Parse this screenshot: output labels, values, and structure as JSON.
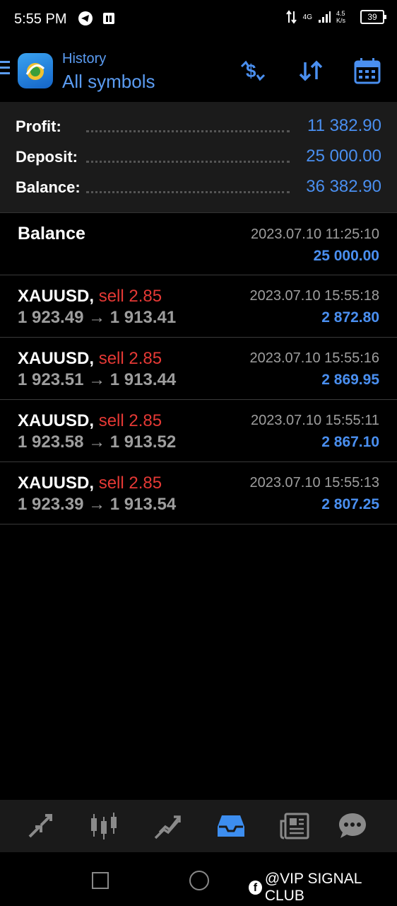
{
  "status": {
    "time": "5:55 PM",
    "network": "4G",
    "speed": "4.5 K/s",
    "battery": "39"
  },
  "header": {
    "small_title": "History",
    "title": "All symbols"
  },
  "summary": [
    {
      "label": "Profit:",
      "value": "11 382.90"
    },
    {
      "label": "Deposit:",
      "value": "25 000.00"
    },
    {
      "label": "Balance:",
      "value": "36 382.90"
    }
  ],
  "balance_row": {
    "title": "Balance",
    "date": "2023.07.10 11:25:10",
    "amount": "25 000.00"
  },
  "trades": [
    {
      "symbol": "XAUUSD,",
      "type": "sell 2.85",
      "prices": "1 923.49 → 1 913.41",
      "date": "2023.07.10 15:55:18",
      "profit": "2 872.80"
    },
    {
      "symbol": "XAUUSD,",
      "type": "sell 2.85",
      "prices": "1 923.51 → 1 913.44",
      "date": "2023.07.10 15:55:16",
      "profit": "2 869.95"
    },
    {
      "symbol": "XAUUSD,",
      "type": "sell 2.85",
      "prices": "1 923.58 → 1 913.52",
      "date": "2023.07.10 15:55:11",
      "profit": "2 867.10"
    },
    {
      "symbol": "XAUUSD,",
      "type": "sell 2.85",
      "prices": "1 923.39 → 1 913.54",
      "date": "2023.07.10 15:55:13",
      "profit": "2 807.25"
    }
  ],
  "watermark": "@VIP SIGNAL CLUB",
  "colors": {
    "accent": "#4a8ff0",
    "sell": "#e53935",
    "active_tab": "#3d8ef0"
  }
}
